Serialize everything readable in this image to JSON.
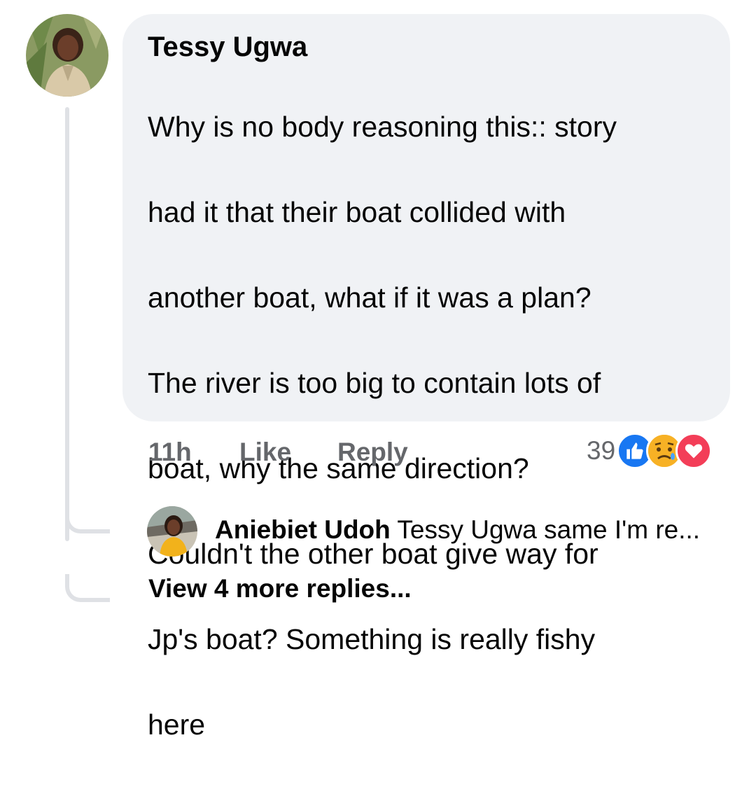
{
  "comment": {
    "author": "Tessy Ugwa",
    "lines": [
      "Why is no body reasoning this:: story",
      "had it that their boat collided with",
      "another boat, what if it was a plan?",
      "The river is too big to contain lots of",
      "boat, why the same direction?",
      "Couldn't the other boat give way for",
      "Jp's boat? Something is really fishy",
      "here"
    ],
    "time": "11h",
    "like_label": "Like",
    "reply_label": "Reply",
    "reaction_count": "39",
    "reaction_icons": [
      "like-icon",
      "sad-icon",
      "love-icon"
    ]
  },
  "reply": {
    "author": "Aniebiet Udoh",
    "text": "Tessy Ugwa same I'm re..."
  },
  "view_more_label": "View 4 more replies...",
  "colors": {
    "bubble": "#f0f2f5",
    "meta_text": "#65676b",
    "like_blue": "#1877f2",
    "love_red": "#f33e58",
    "sad_yellow": "#f7b125"
  }
}
